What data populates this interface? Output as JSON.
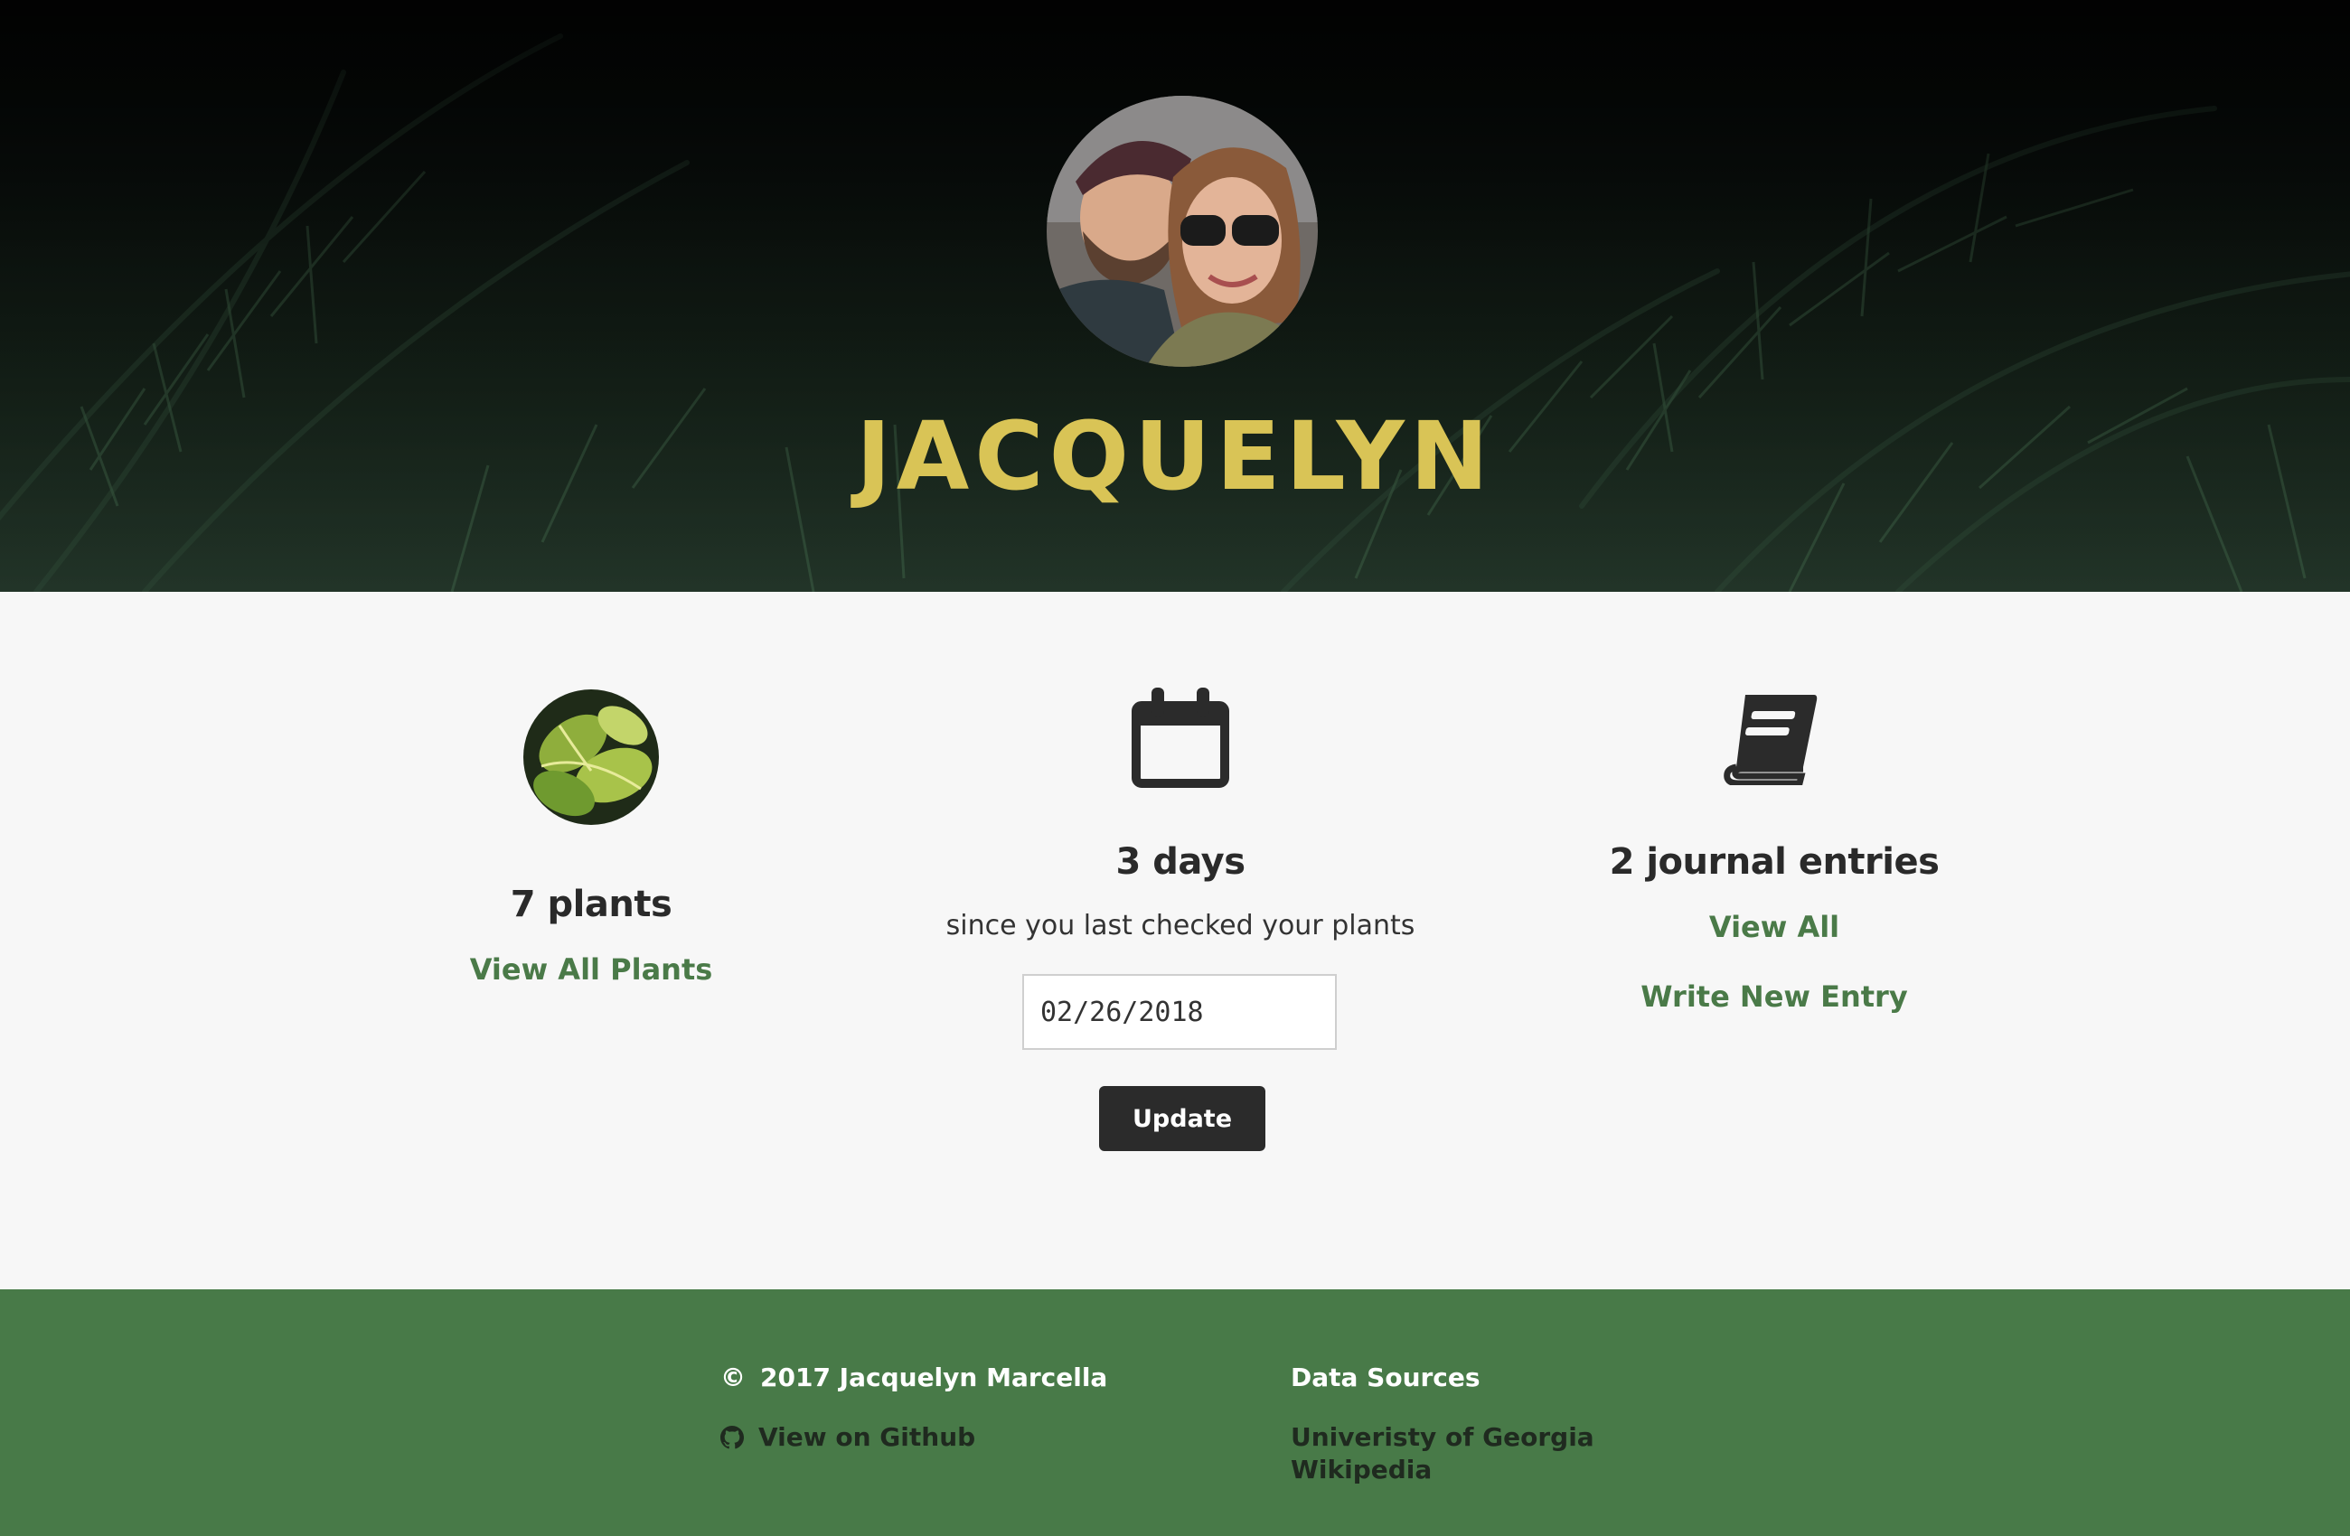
{
  "hero": {
    "name": "JACQUELYN"
  },
  "stats": {
    "plants": {
      "title": "7 plants",
      "link": "View All Plants"
    },
    "days": {
      "title": "3 days",
      "subtitle": "since you last checked your plants",
      "date_value": "02/26/2018",
      "button": "Update"
    },
    "journal": {
      "title": "2 journal entries",
      "link_view": "View All",
      "link_new": "Write New Entry"
    }
  },
  "footer": {
    "copyright_symbol": "©",
    "copyright": "2017 Jacquelyn Marcella",
    "github": "View on Github",
    "data_sources_heading": "Data Sources",
    "sources": [
      "Univeristy of Georgia",
      "Wikipedia"
    ]
  },
  "colors": {
    "accent_gold": "#d9c456",
    "link_green": "#4a7a48",
    "footer_green": "#487a48",
    "button_dark": "#2b2b2b"
  },
  "icons": {
    "stat_days": "calendar-icon",
    "stat_journal": "book-icon",
    "footer_github": "github-icon"
  }
}
